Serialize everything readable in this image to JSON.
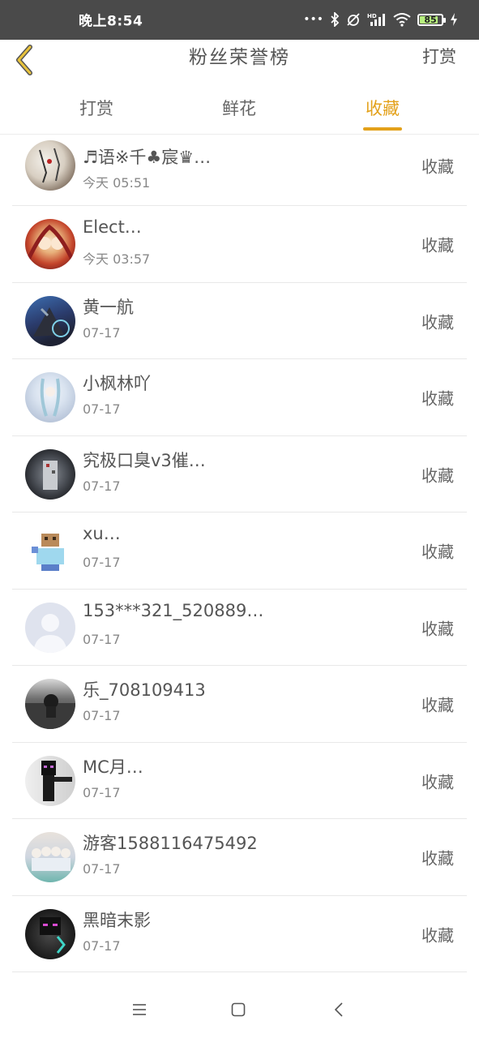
{
  "status_bar": {
    "time": "晚上8:54",
    "battery_level": "85",
    "icons": [
      "more-dots-icon",
      "bluetooth-icon",
      "alarm-off-icon",
      "hd-signal-icon",
      "wifi-icon",
      "battery-icon",
      "charging-icon"
    ]
  },
  "header": {
    "title": "粉丝荣誉榜",
    "action_label": "打赏"
  },
  "tabs": [
    {
      "label": "打赏",
      "active": false
    },
    {
      "label": "鲜花",
      "active": false
    },
    {
      "label": "收藏",
      "active": true
    }
  ],
  "colors": {
    "accent": "#e3a11a",
    "status_bar_bg": "#4a4a4a"
  },
  "items": [
    {
      "name": "♬语※千♣宸♛…",
      "date": "今天 05:51",
      "tag": "收藏"
    },
    {
      "name": "Elect…",
      "date": "今天 03:57",
      "tag": "收藏"
    },
    {
      "name": "黄一航",
      "date": "07-17",
      "tag": "收藏"
    },
    {
      "name": "小枫林吖",
      "date": "07-17",
      "tag": "收藏"
    },
    {
      "name": "究极口臭v3催…",
      "date": "07-17",
      "tag": "收藏"
    },
    {
      "name": "xu…",
      "date": "07-17",
      "tag": "收藏"
    },
    {
      "name": "153***321_520889…",
      "date": "07-17",
      "tag": "收藏"
    },
    {
      "name": "乐_708109413",
      "date": "07-17",
      "tag": "收藏"
    },
    {
      "name": "MC月…",
      "date": "07-17",
      "tag": "收藏"
    },
    {
      "name": "游客1588116475492",
      "date": "07-17",
      "tag": "收藏"
    },
    {
      "name": "黑暗末影",
      "date": "07-17",
      "tag": "收藏"
    }
  ]
}
